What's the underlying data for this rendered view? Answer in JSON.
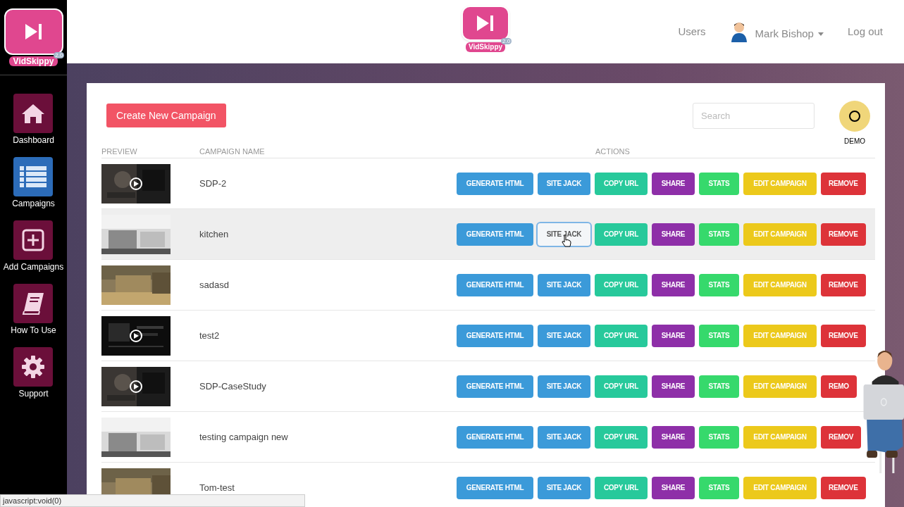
{
  "sidebar": {
    "logo": {
      "name": "VidSkippy",
      "version": "2.0"
    },
    "items": [
      {
        "label": "Dashboard",
        "selected": false
      },
      {
        "label": "Campaigns",
        "selected": true
      },
      {
        "label": "Add Campaigns",
        "selected": false
      },
      {
        "label": "How To Use",
        "selected": false
      },
      {
        "label": "Support",
        "selected": false
      }
    ]
  },
  "header": {
    "logo": {
      "name": "VidSkippy",
      "version": "2.0"
    },
    "nav": [
      "Users"
    ],
    "user": "Mark Bishop",
    "logout": "Log out"
  },
  "toolbar": {
    "create_button": "Create New Campaign",
    "search": {
      "placeholder": "Search"
    },
    "demo": "DEMO"
  },
  "table": {
    "columns": [
      "PREVIEW",
      "CAMPAIGN NAME",
      "ACTIONS"
    ],
    "rows": [
      {
        "name": "SDP-2",
        "hovered": false,
        "actions": [
          {
            "kind": "html",
            "label": "GENERATE HTML",
            "focused": false
          },
          {
            "kind": "jack",
            "label": "SITE JACK",
            "focused": false
          },
          {
            "kind": "copy",
            "label": "COPY URL",
            "focused": false
          },
          {
            "kind": "share",
            "label": "SHARE",
            "focused": false
          },
          {
            "kind": "stats",
            "label": "STATS",
            "focused": false
          },
          {
            "kind": "edit",
            "label": "EDIT CAMPAIGN",
            "focused": false
          },
          {
            "kind": "remove",
            "label": "REMOVE",
            "focused": false
          }
        ]
      },
      {
        "name": "kitchen",
        "hovered": true,
        "actions": [
          {
            "kind": "html",
            "label": "GENERATE HTML",
            "focused": false
          },
          {
            "kind": "jack",
            "label": "SITE JACK",
            "focused": true
          },
          {
            "kind": "copy",
            "label": "COPY URL",
            "focused": false
          },
          {
            "kind": "share",
            "label": "SHARE",
            "focused": false
          },
          {
            "kind": "stats",
            "label": "STATS",
            "focused": false
          },
          {
            "kind": "edit",
            "label": "EDIT CAMPAIGN",
            "focused": false
          },
          {
            "kind": "remove",
            "label": "REMOVE",
            "focused": false
          }
        ]
      },
      {
        "name": "sadasd",
        "hovered": false,
        "actions": [
          {
            "kind": "html",
            "label": "GENERATE HTML",
            "focused": false
          },
          {
            "kind": "jack",
            "label": "SITE JACK",
            "focused": false
          },
          {
            "kind": "copy",
            "label": "COPY URL",
            "focused": false
          },
          {
            "kind": "share",
            "label": "SHARE",
            "focused": false
          },
          {
            "kind": "stats",
            "label": "STATS",
            "focused": false
          },
          {
            "kind": "edit",
            "label": "EDIT CAMPAIGN",
            "focused": false
          },
          {
            "kind": "remove",
            "label": "REMOVE",
            "focused": false
          }
        ]
      },
      {
        "name": "test2",
        "hovered": false,
        "actions": [
          {
            "kind": "html",
            "label": "GENERATE HTML",
            "focused": false
          },
          {
            "kind": "jack",
            "label": "SITE JACK",
            "focused": false
          },
          {
            "kind": "copy",
            "label": "COPY URL",
            "focused": false
          },
          {
            "kind": "share",
            "label": "SHARE",
            "focused": false
          },
          {
            "kind": "stats",
            "label": "STATS",
            "focused": false
          },
          {
            "kind": "edit",
            "label": "EDIT CAMPAIGN",
            "focused": false
          },
          {
            "kind": "remove",
            "label": "REMOVE",
            "focused": false
          }
        ]
      },
      {
        "name": "SDP-CaseStudy",
        "hovered": false,
        "actions": [
          {
            "kind": "html",
            "label": "GENERATE HTML",
            "focused": false
          },
          {
            "kind": "jack",
            "label": "SITE JACK",
            "focused": false
          },
          {
            "kind": "copy",
            "label": "COPY URL",
            "focused": false
          },
          {
            "kind": "share",
            "label": "SHARE",
            "focused": false
          },
          {
            "kind": "stats",
            "label": "STATS",
            "focused": false
          },
          {
            "kind": "edit",
            "label": "EDIT CAMPAIGN",
            "focused": false
          },
          {
            "kind": "remove",
            "label": "REMO",
            "focused": false
          }
        ]
      },
      {
        "name": "testing campaign new",
        "hovered": false,
        "actions": [
          {
            "kind": "html",
            "label": "GENERATE HTML",
            "focused": false
          },
          {
            "kind": "jack",
            "label": "SITE JACK",
            "focused": false
          },
          {
            "kind": "copy",
            "label": "COPY URL",
            "focused": false
          },
          {
            "kind": "share",
            "label": "SHARE",
            "focused": false
          },
          {
            "kind": "stats",
            "label": "STATS",
            "focused": false
          },
          {
            "kind": "edit",
            "label": "EDIT CAMPAIGN",
            "focused": false
          },
          {
            "kind": "remove",
            "label": "REMOV",
            "focused": false
          }
        ]
      },
      {
        "name": "Tom-test",
        "hovered": false,
        "actions": [
          {
            "kind": "html",
            "label": "GENERATE HTML",
            "focused": false
          },
          {
            "kind": "jack",
            "label": "SITE JACK",
            "focused": false
          },
          {
            "kind": "copy",
            "label": "COPY URL",
            "focused": false
          },
          {
            "kind": "share",
            "label": "SHARE",
            "focused": false
          },
          {
            "kind": "stats",
            "label": "STATS",
            "focused": false
          },
          {
            "kind": "edit",
            "label": "EDIT CAMPAIGN",
            "focused": false
          },
          {
            "kind": "remove",
            "label": "REMOVE",
            "focused": false
          }
        ]
      }
    ]
  },
  "status_bar": "javascript:void(0)"
}
